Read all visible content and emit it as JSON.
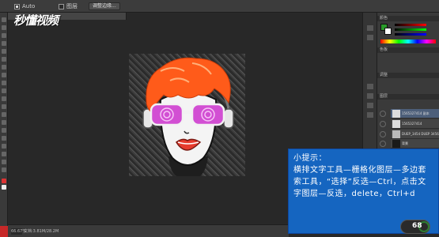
{
  "watermark": {
    "brand": "秒懂视频"
  },
  "options_bar": {
    "anti_alias_label": "Auto",
    "sample_label": "图层",
    "refine_label": "调整边缘..."
  },
  "status_bar": {
    "zoom": "66.67%",
    "doc_info": "文档:3.81M/28.2M"
  },
  "right_panel": {
    "color_tab": "颜色",
    "swatches_tab": "色板",
    "adjust_tab": "调整",
    "layers_tab": "图层",
    "layers": [
      {
        "name": "1565327414 副本"
      },
      {
        "name": "1565327414"
      },
      {
        "name": "DUEP_3454 DUEP 3456"
      },
      {
        "name": "背景"
      }
    ]
  },
  "tip": {
    "title": "小提示：",
    "body": "横排文字工具—栅格化图层—多边套索工具，“选择”反选—Ctrl，点击文字图层—反选，delete，Ctrl+d"
  },
  "speed_badge": {
    "value": "68"
  },
  "colors": {
    "tip_bg": "#1565c0",
    "hair": "#ff5b1a",
    "lens": "#d24fd3",
    "lips": "#e63b2e"
  }
}
